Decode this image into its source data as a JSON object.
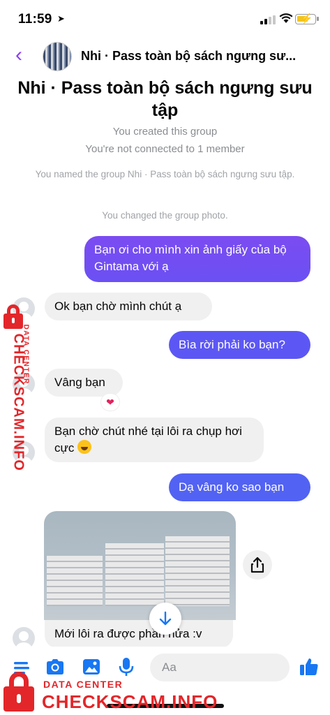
{
  "status_bar": {
    "time": "11:59"
  },
  "header": {
    "title": "Nhi · Pass toàn bộ sách ngưng sư..."
  },
  "intro": {
    "title": "Nhi · Pass toàn bộ sách ngưng sưu tập",
    "created": "You created this group",
    "not_connected": "You're not connected to 1 member",
    "named": "You named the group Nhi · Pass toàn bộ sách ngưng sưu tập.",
    "changed_photo": "You changed the group photo."
  },
  "messages": [
    {
      "side": "out",
      "text": "Bạn ơi cho mình xin ảnh giấy của bộ Gintama với ạ"
    },
    {
      "side": "in",
      "text": "Ok bạn chờ mình chút ạ"
    },
    {
      "side": "out",
      "text": "Bìa rời phải ko bạn?"
    },
    {
      "side": "in",
      "text": "Vâng bạn",
      "reaction": "❤"
    },
    {
      "side": "in",
      "text": "Bạn chờ chút nhé tại lôi ra chụp hơi cực"
    },
    {
      "side": "out",
      "text": "Dạ vâng ko sao bạn"
    },
    {
      "side": "in",
      "text": "Mới lôi ra được phần nửa :v"
    }
  ],
  "composer": {
    "placeholder": "Aa"
  },
  "watermark": {
    "small": "DATA CENTER",
    "big": "CHECKSCAM.INFO"
  },
  "colors": {
    "accent": "#8a3ffc",
    "outgoing": "#6a4cf5",
    "incoming": "#f0f0f0",
    "icons": "#1877f2",
    "watermark": "#e3262a"
  },
  "icons": [
    "back-chevron-icon",
    "menu-icon",
    "camera-icon",
    "gallery-icon",
    "microphone-icon",
    "emoji-icon",
    "thumbs-up-icon",
    "share-icon",
    "arrow-down-icon"
  ]
}
